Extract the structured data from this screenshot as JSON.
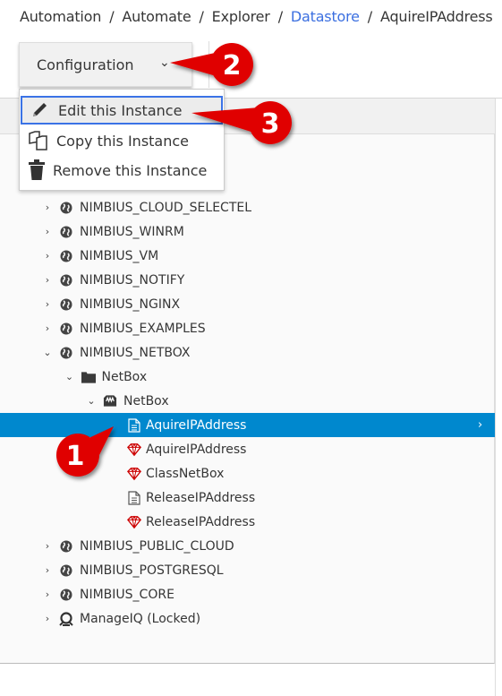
{
  "breadcrumb": [
    "Automation",
    "Automate",
    "Explorer",
    "Datastore",
    "AquireIPAddress"
  ],
  "breadcrumb_separator": "/",
  "toolbar": {
    "configuration_label": "Configuration",
    "chevron": "⌄"
  },
  "menu": {
    "items": [
      {
        "label": "Edit this Instance",
        "icon": "pencil-icon",
        "active": true
      },
      {
        "label": "Copy this Instance",
        "icon": "copy-icon"
      },
      {
        "label": "Remove this Instance",
        "icon": "trash-icon"
      }
    ]
  },
  "tree": {
    "rows": [
      {
        "label": "NIMBIUS_CLOUD_SELECTEL",
        "level": 0,
        "icon": "globe-icon",
        "toggle": "›"
      },
      {
        "label": "NIMBIUS_WINRM",
        "level": 0,
        "icon": "globe-icon",
        "toggle": "›"
      },
      {
        "label": "NIMBIUS_VM",
        "level": 0,
        "icon": "globe-icon",
        "toggle": "›"
      },
      {
        "label": "NIMBIUS_NOTIFY",
        "level": 0,
        "icon": "globe-icon",
        "toggle": "›"
      },
      {
        "label": "NIMBIUS_NGINX",
        "level": 0,
        "icon": "globe-icon",
        "toggle": "›"
      },
      {
        "label": "NIMBIUS_EXAMPLES",
        "level": 0,
        "icon": "globe-icon",
        "toggle": "›"
      },
      {
        "label": "NIMBIUS_NETBOX",
        "level": 0,
        "icon": "globe-icon",
        "toggle": "⌄"
      },
      {
        "label": "NetBox",
        "level": 1,
        "icon": "folder-icon",
        "toggle": "⌄"
      },
      {
        "label": "NetBox",
        "level": 2,
        "icon": "class-icon",
        "toggle": "⌄"
      },
      {
        "label": "AquireIPAddress",
        "level": 3,
        "icon": "instance-icon",
        "selected": true
      },
      {
        "label": "AquireIPAddress",
        "level": 3,
        "icon": "ruby-method-icon"
      },
      {
        "label": "ClassNetBox",
        "level": 3,
        "icon": "ruby-method-icon"
      },
      {
        "label": "ReleaseIPAddress",
        "level": 3,
        "icon": "instance-icon"
      },
      {
        "label": "ReleaseIPAddress",
        "level": 3,
        "icon": "ruby-method-icon"
      },
      {
        "label": "NIMBIUS_PUBLIC_CLOUD",
        "level": 0,
        "icon": "globe-icon",
        "toggle": "›"
      },
      {
        "label": "NIMBIUS_POSTGRESQL",
        "level": 0,
        "icon": "globe-icon",
        "toggle": "›"
      },
      {
        "label": "NIMBIUS_CORE",
        "level": 0,
        "icon": "globe-icon",
        "toggle": "›"
      },
      {
        "label": "ManageIQ (Locked)",
        "level": 0,
        "icon": "manageiq-lock-icon",
        "toggle": "›"
      }
    ]
  },
  "callouts": [
    "1",
    "2",
    "3"
  ],
  "colors": {
    "selected": "#0088ce",
    "link": "#3b6fe0",
    "callout": "#e00000",
    "ruby": "#cc0000"
  }
}
